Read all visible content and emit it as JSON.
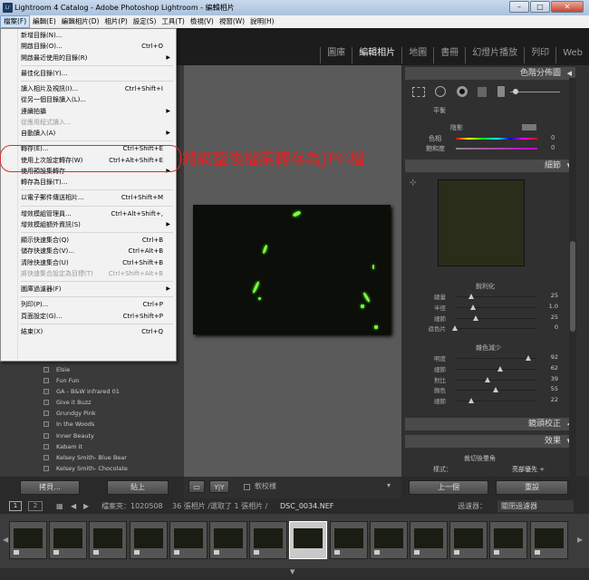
{
  "window": {
    "title": "Lightroom 4 Catalog - Adobe Photoshop Lightroom - 編輯相片",
    "app_icon": "Lr",
    "minimize": "–",
    "maximize": "□",
    "close": "✕"
  },
  "menubar": [
    "檔案(F)",
    "編輯(E)",
    "編輯相片(D)",
    "相片(P)",
    "設定(S)",
    "工具(T)",
    "檢視(V)",
    "視窗(W)",
    "說明(H)"
  ],
  "modules": [
    "圖庫",
    "編輯相片",
    "地圖",
    "書冊",
    "幻燈片播放",
    "列印",
    "Web"
  ],
  "file_menu": [
    {
      "label": "新增目錄(N)...",
      "shortcut": ""
    },
    {
      "label": "開啟目錄(O)...",
      "shortcut": "Ctrl+O"
    },
    {
      "label": "開啟最近使用的目錄(R)",
      "shortcut": "",
      "submenu": true
    },
    {
      "sep": true
    },
    {
      "label": "最佳化目錄(Y)...",
      "shortcut": ""
    },
    {
      "sep": true
    },
    {
      "label": "讀入相片及視訊(I)...",
      "shortcut": "Ctrl+Shift+I"
    },
    {
      "label": "從另一個目錄讀入(L)...",
      "shortcut": ""
    },
    {
      "label": "連續拍攝",
      "shortcut": "",
      "submenu": true
    },
    {
      "label": "從應用程式讀入...",
      "shortcut": "",
      "disabled": true
    },
    {
      "label": "自動讀入(A)",
      "shortcut": "",
      "submenu": true
    },
    {
      "sep": true
    },
    {
      "label": "轉存(E)...",
      "shortcut": "Ctrl+Shift+E"
    },
    {
      "label": "使用上次設定轉存(W)",
      "shortcut": "Ctrl+Alt+Shift+E"
    },
    {
      "label": "使用預設集轉存",
      "shortcut": "",
      "submenu": true
    },
    {
      "label": "轉存為目錄(T)...",
      "shortcut": ""
    },
    {
      "sep": true
    },
    {
      "label": "以電子郵件傳送相片...",
      "shortcut": "Ctrl+Shift+M"
    },
    {
      "sep": true
    },
    {
      "label": "增效模組管理員...",
      "shortcut": "Ctrl+Alt+Shift+,"
    },
    {
      "label": "增效模組額外資訊(S)",
      "shortcut": "",
      "submenu": true
    },
    {
      "sep": true
    },
    {
      "label": "顯示快速集合(Q)",
      "shortcut": "Ctrl+B"
    },
    {
      "label": "儲存快速集合(V)...",
      "shortcut": "Ctrl+Alt+B"
    },
    {
      "label": "清除快速集合(U)",
      "shortcut": "Ctrl+Shift+B"
    },
    {
      "label": "將快速集合設定為目標(T)",
      "shortcut": "Ctrl+Shift+Alt+B",
      "disabled": true
    },
    {
      "sep": true
    },
    {
      "label": "圖庫過濾器(F)",
      "shortcut": "",
      "submenu": true
    },
    {
      "sep": true
    },
    {
      "label": "列印(P)...",
      "shortcut": "Ctrl+P"
    },
    {
      "label": "頁面設定(G)...",
      "shortcut": "Ctrl+Shift+P"
    },
    {
      "sep": true
    },
    {
      "label": "結束(X)",
      "shortcut": "Ctrl+Q"
    }
  ],
  "annotation": "將調整後檔案轉存為JPG檔",
  "presets": [
    "Elsie",
    "Fun Fun",
    "GA - B&W infrared 01",
    "Give it Buzz",
    "Grundgy Pink",
    "In the Woods",
    "Inner Beauty",
    "Kabam It",
    "Kelsey Smith- Blue Bear",
    "Kelsey Smith- Chocolate"
  ],
  "left_buttons": {
    "copy": "拷貝...",
    "paste": "貼上"
  },
  "center_toolbar": {
    "compare": "Y|Y",
    "softproof": "軟校樣"
  },
  "right_panel": {
    "tone_header": "色階分佈圖",
    "detail_header": "細節",
    "lens_header": "鏡頭校正",
    "effects_header": "效果",
    "split_labels": {
      "shadows": "陰影",
      "hue": "色相",
      "saturation": "飽和度"
    },
    "split_values": [
      "0",
      "0"
    ],
    "balance_label": "平衡",
    "sharpen_title": "銳利化",
    "sharpen": [
      {
        "label": "總量",
        "value": "25",
        "pos": 0.2
      },
      {
        "label": "半徑",
        "value": "1.0",
        "pos": 0.22
      },
      {
        "label": "細節",
        "value": "25",
        "pos": 0.25
      },
      {
        "label": "遮色片",
        "value": "0",
        "pos": 0.0
      }
    ],
    "noise_title": "雜色減少",
    "noise": [
      {
        "label": "明度",
        "value": "92",
        "pos": 0.9
      },
      {
        "label": "細節",
        "value": "62",
        "pos": 0.55
      },
      {
        "label": "對比",
        "value": "39",
        "pos": 0.4
      },
      {
        "label": "顏色",
        "value": "55",
        "pos": 0.5
      },
      {
        "label": "細節",
        "value": "22",
        "pos": 0.2
      }
    ],
    "vignette_title": "裁切後暈角",
    "style_label": "樣式：",
    "style_value": "亮部優先 ÷",
    "prev_button": "上一個",
    "reset_button": "重設"
  },
  "filmbar": {
    "source": "檔案夾：1020508",
    "count": "36 張相片 /選取了 1 張相片 /",
    "filename": "DSC_0034.NEF",
    "filter_label": "過濾器：",
    "filter_value": "關閉過濾器",
    "page1": "1",
    "page2": "2"
  }
}
